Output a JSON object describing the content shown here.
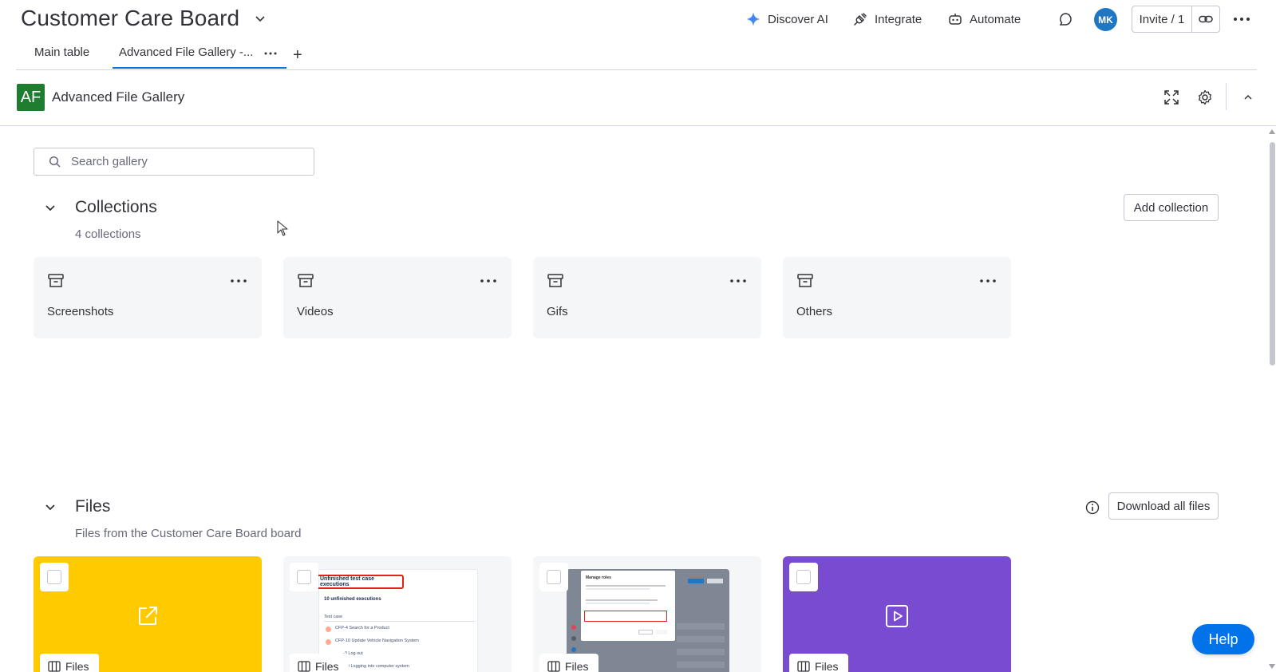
{
  "header": {
    "board_title": "Customer Care Board",
    "discover_ai": "Discover AI",
    "integrate": "Integrate",
    "automate": "Automate",
    "avatar_initials": "MK",
    "avatar_color": "#1f76c2",
    "invite_label": "Invite / 1"
  },
  "tabs": [
    {
      "label": "Main table"
    },
    {
      "label": "Advanced File Gallery -..."
    }
  ],
  "app": {
    "logo_text": "AF",
    "logo_color": "#1f7d2f",
    "name": "Advanced File Gallery"
  },
  "search": {
    "placeholder": "Search gallery",
    "value": ""
  },
  "collections": {
    "title": "Collections",
    "count_label": "4 collections",
    "add_button": "Add collection",
    "items": [
      {
        "label": "Screenshots"
      },
      {
        "label": "Videos"
      },
      {
        "label": "Gifs"
      },
      {
        "label": "Others"
      }
    ]
  },
  "files": {
    "title": "Files",
    "subtitle": "Files from the Customer Care Board board",
    "download_button": "Download all files",
    "items": [
      {
        "type": "link",
        "bg": "#ffcb00",
        "badge": "Files"
      },
      {
        "type": "screenshot",
        "bg": "#f5f6f8",
        "badge": "Files",
        "preview": {
          "heading": "Unfinished test case executions",
          "count": "10 unfinished executions",
          "column": "Test case",
          "rows": [
            "CFP-4 Search for a Product",
            "CFP-10 Update Vehicle Navigation System",
            "-3 Log out",
            "-49 Logging into computer system"
          ]
        }
      },
      {
        "type": "screenshot",
        "bg": "#f5f6f8",
        "badge": "Files",
        "preview": {
          "heading": "Manage roles"
        }
      },
      {
        "type": "video",
        "bg": "#784bd1",
        "badge": "Files"
      }
    ]
  },
  "help_button": "Help",
  "accent_color": "#0073ea"
}
